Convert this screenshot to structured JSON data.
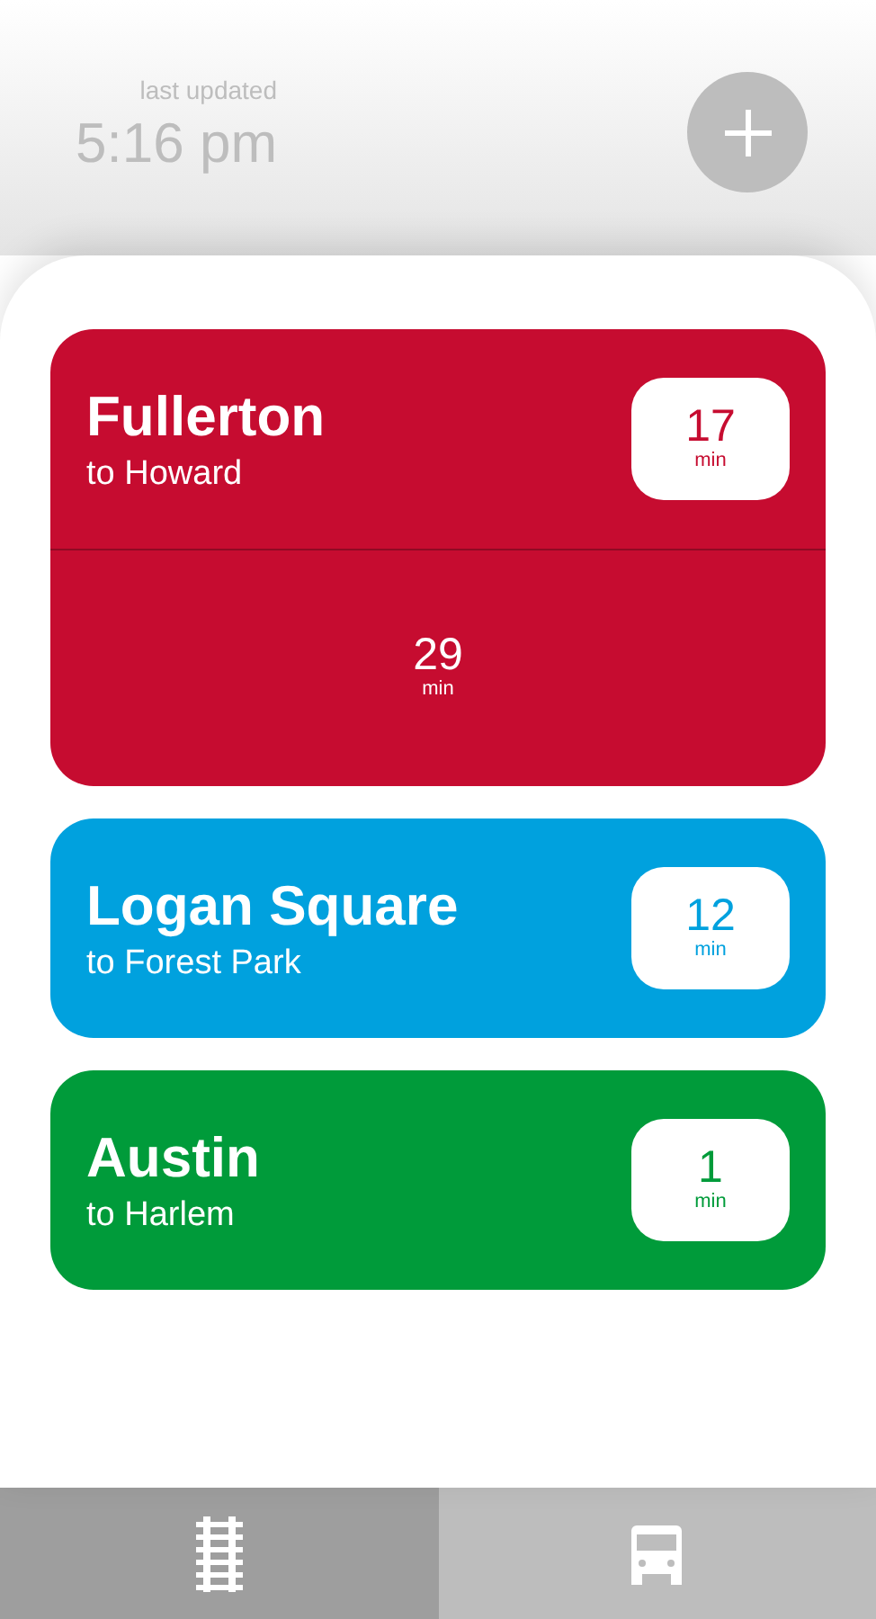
{
  "header": {
    "caption": "last updated",
    "time": "5:16 pm"
  },
  "stations": [
    {
      "name": "Fullerton",
      "direction": "to Howard",
      "color": "#c60c30",
      "next": {
        "value": "17",
        "unit": "min"
      },
      "later": [
        {
          "value": "29",
          "unit": "min"
        }
      ]
    },
    {
      "name": "Logan Square",
      "direction": "to Forest Park",
      "color": "#00a1de",
      "next": {
        "value": "12",
        "unit": "min"
      }
    },
    {
      "name": "Austin",
      "direction": "to Harlem",
      "color": "#009b3a",
      "next": {
        "value": "1",
        "unit": "min"
      }
    }
  ],
  "tabs": [
    {
      "kind": "train",
      "selected": true
    },
    {
      "kind": "bus",
      "selected": false
    }
  ]
}
